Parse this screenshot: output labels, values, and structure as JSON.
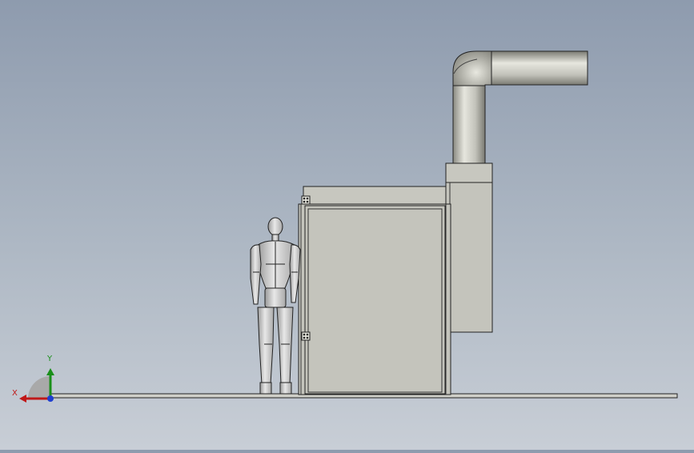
{
  "viewport": {
    "background_top": "#8e9bae",
    "background_bottom": "#c8ced6",
    "model_fill": "#c4c4bc",
    "edge_color": "#1f1f1f"
  },
  "triad": {
    "x_label": "X",
    "y_label": "Y",
    "x_color": "#c01818",
    "y_color": "#1a8f1a",
    "z_color": "#1f3fd0"
  }
}
